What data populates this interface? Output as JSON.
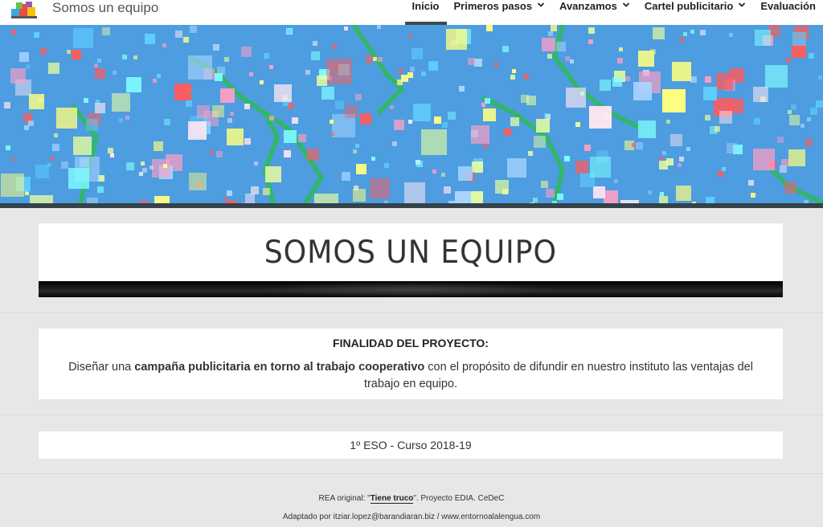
{
  "header": {
    "site_title": "Somos un equipo",
    "nav": [
      {
        "label": "Inicio",
        "active": true,
        "has_dropdown": false
      },
      {
        "label": "Primeros pasos",
        "active": false,
        "has_dropdown": true
      },
      {
        "label": "Avanzamos",
        "active": false,
        "has_dropdown": true
      },
      {
        "label": "Cartel publicitario",
        "active": false,
        "has_dropdown": true
      },
      {
        "label": "Evaluación",
        "active": false,
        "has_dropdown": false
      }
    ]
  },
  "hero": {
    "background_color": "#4d9de0",
    "square_colors": [
      "#ff9ec4",
      "#ffff80",
      "#80ffff",
      "#ff5b5b",
      "#ffe7f3",
      "#a8d5ff",
      "#e9ff9e",
      "#5fcfff"
    ],
    "crack_color": "#2fba5a"
  },
  "main": {
    "title": "SOMOS UN EQUIPO",
    "purpose": {
      "heading": "FINALIDAD DEL PROYECTO:",
      "text_before": "Diseñar una ",
      "text_bold": "campaña publicitaria en torno al trabajo cooperativo",
      "text_after": " con el propósito de difundir en nuestro instituto las ventajas del trabajo en equipo."
    },
    "course": "1º ESO - Curso 2018-19"
  },
  "footer": {
    "line1_prefix": "REA original: \"",
    "line1_link": "Tiene truco",
    "line1_suffix": "\". Proyecto EDIA. CeDeC",
    "line2": "Adaptado por itziar.lopez@barandiaran.biz / www.entornoalalengua.com"
  }
}
